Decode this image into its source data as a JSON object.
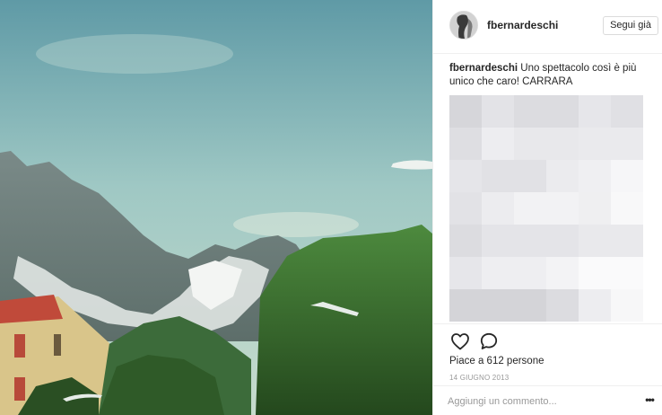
{
  "post": {
    "username": "fbernardeschi",
    "follow_label": "Segui già",
    "caption_user": "fbernardeschi",
    "caption_text": " Uno spettacolo così è più unico che caro! CARRARA",
    "likes_text": "Piace a 612 persone",
    "date_text": "14 GIUGNO 2013",
    "comment_placeholder": "Aggiungi un commento...",
    "more_label": "•••"
  },
  "icons": {
    "like": "heart-icon",
    "comment": "speech-bubble-icon",
    "more": "more-options-icon"
  },
  "colors": {
    "border": "#efefef",
    "text": "#262626",
    "muted": "#999999",
    "blur_tones": [
      "#f4f4f6",
      "#e4e4e8",
      "#d9d9dd",
      "#ececef",
      "#f8f8f9"
    ]
  }
}
